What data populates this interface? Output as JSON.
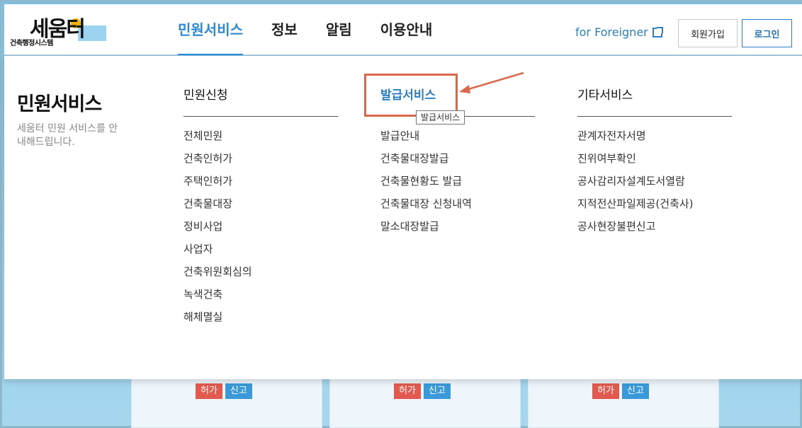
{
  "header": {
    "logo_text": "세움터",
    "logo_sub": "건축행정시스템",
    "nav": [
      "민원서비스",
      "정보",
      "알림",
      "이용안내"
    ],
    "foreigner_link": "for Foreigner",
    "join_label": "회원가입",
    "login_label": "로그인"
  },
  "panel": {
    "title": "민원서비스",
    "desc": "세움터 민원 서비스를 안내해드립니다.",
    "columns": [
      {
        "head": "민원신청",
        "items": [
          "전체민원",
          "건축인허가",
          "주택인허가",
          "건축물대장",
          "정비사업",
          "사업자",
          "건축위원회심의",
          "녹색건축",
          "해체멸실"
        ]
      },
      {
        "head": "발급서비스",
        "items": [
          "발급안내",
          "건축물대장발급",
          "건축물현황도 발급",
          "건축물대장 신청내역",
          "말소대장발급"
        ]
      },
      {
        "head": "기타서비스",
        "items": [
          "관계자전자서명",
          "진위여부확인",
          "공사감리자설계도서열람",
          "지적전산파일제공(건축사)",
          "공사현장불편신고"
        ]
      }
    ],
    "tooltip": "발급서비스"
  },
  "background_cards": [
    {
      "badge_red": "허가",
      "badge_blue": "신고"
    },
    {
      "badge_red": "허가",
      "badge_blue": "신고"
    },
    {
      "badge_red": "허가",
      "badge_blue": "신고"
    }
  ],
  "colors": {
    "accent": "#2b8ad3",
    "annotation": "#d9694a"
  }
}
